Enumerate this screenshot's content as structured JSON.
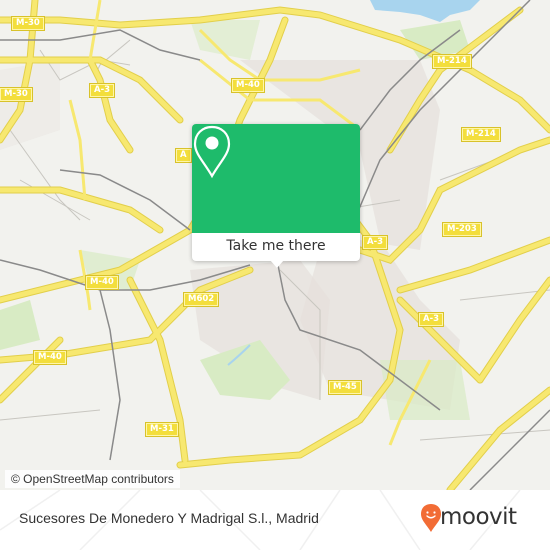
{
  "map": {
    "road_labels": [
      {
        "id": "m30-top",
        "text": "M-30"
      },
      {
        "id": "m30-left",
        "text": "M-30"
      },
      {
        "id": "a3-top",
        "text": "A-3"
      },
      {
        "id": "m40-top",
        "text": "M-40"
      },
      {
        "id": "m214-top",
        "text": "M-214"
      },
      {
        "id": "m214-right",
        "text": "M-214"
      },
      {
        "id": "a-partial",
        "text": "A"
      },
      {
        "id": "a3-mid",
        "text": "A-3"
      },
      {
        "id": "m203",
        "text": "M-203"
      },
      {
        "id": "m40-mid",
        "text": "M-40"
      },
      {
        "id": "m602",
        "text": "M602"
      },
      {
        "id": "a3-lower",
        "text": "A-3"
      },
      {
        "id": "m40-left",
        "text": "M-40"
      },
      {
        "id": "m45",
        "text": "M-45"
      },
      {
        "id": "m31",
        "text": "M-31"
      }
    ],
    "colors": {
      "background": "#f2f2ee",
      "motorway": "#f7e870",
      "motorway_edge": "#e2cf4a",
      "rail": "#8a8a8a",
      "park": "#d8ebc4",
      "urban": "#e6e0dc",
      "water": "#a8d4ee"
    }
  },
  "popup": {
    "icon": "map-pin-icon",
    "button_label": "Take me there",
    "accent_color": "#1ebb6b"
  },
  "attribution": "© OpenStreetMap contributors",
  "footer": {
    "title": "Sucesores De Monedero Y Madrigal S.l., Madrid",
    "brand": "moovit",
    "brand_color": "#f26c35"
  }
}
